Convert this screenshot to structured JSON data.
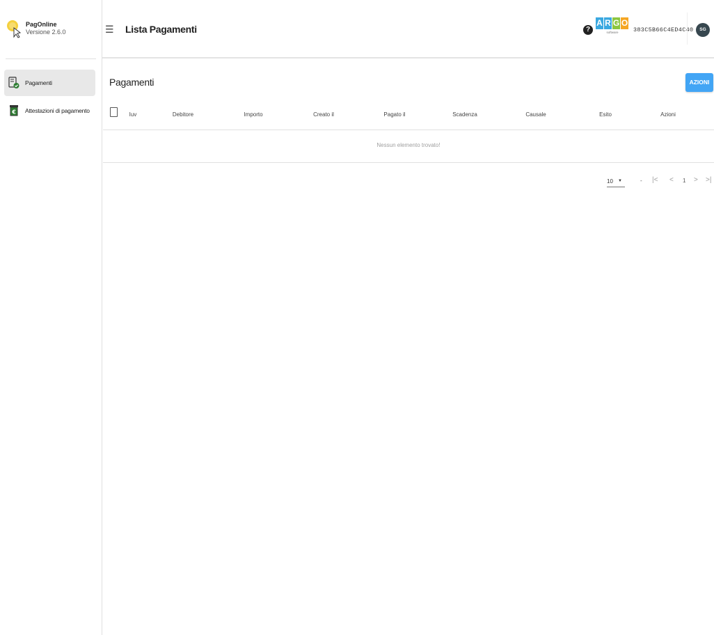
{
  "app": {
    "name": "PagOnline",
    "version": "Versione 2.6.0"
  },
  "sidebar": {
    "items": [
      {
        "label": "Pagamenti",
        "active": true,
        "icon": "document-check-icon"
      },
      {
        "label": "Attestazioni di pagamento",
        "active": false,
        "icon": "receipt-euro-icon"
      }
    ]
  },
  "header": {
    "menu_icon": "☰",
    "title": "Lista Pagamenti",
    "help_icon": "?",
    "logo": {
      "letters": [
        "A",
        "R",
        "G",
        "O"
      ],
      "subtitle": "software"
    },
    "session_code": "383C5B66C4ED4C40",
    "avatar_initials": "SG"
  },
  "main": {
    "section_title": "Pagamenti",
    "actions_label": "AZIONI",
    "table": {
      "columns": [
        "Iuv",
        "Debitore",
        "Importo",
        "Creato il",
        "Pagato il",
        "Scadenza",
        "Causale",
        "Esito",
        "Azioni"
      ],
      "rows": [],
      "empty_message": "Nessun elemento trovato!"
    },
    "pagination": {
      "page_size": "10",
      "range": "-",
      "current_page": "1"
    }
  },
  "colors": {
    "accent": "#42a5f5",
    "avatar": "#37474f",
    "logo_a": "#3aa8e0",
    "logo_r": "#3aa8e0",
    "logo_g": "#8cc63f",
    "logo_o": "#f5a623"
  }
}
